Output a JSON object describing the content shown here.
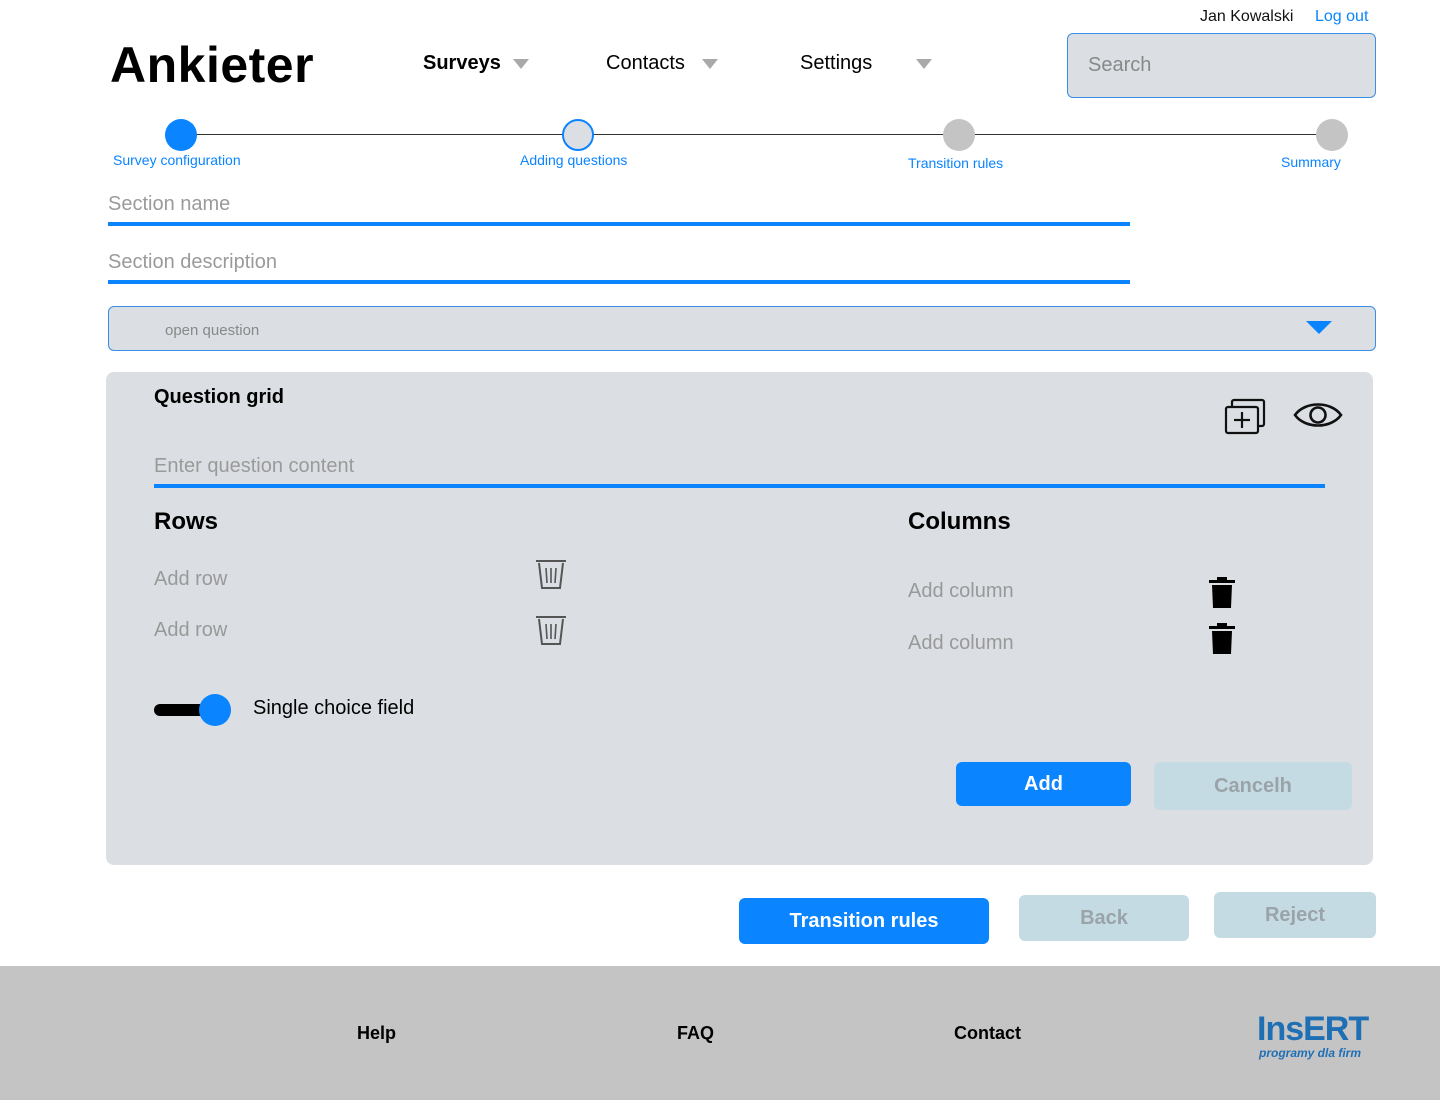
{
  "user": {
    "name": "Jan Kowalski",
    "logout_label": "Log out"
  },
  "app": {
    "title": "Ankieter"
  },
  "nav": [
    {
      "label": "Surveys",
      "active": true
    },
    {
      "label": "Contacts",
      "active": false
    },
    {
      "label": "Settings",
      "active": false
    }
  ],
  "search": {
    "placeholder": "Search"
  },
  "stepper": {
    "steps": [
      {
        "label": "Survey configuration",
        "state": "completed"
      },
      {
        "label": "Adding questions",
        "state": "current"
      },
      {
        "label": "Transition rules",
        "state": "pending"
      },
      {
        "label": "Summary",
        "state": "pending"
      }
    ]
  },
  "section": {
    "name_placeholder": "Section name",
    "description_placeholder": "Section description"
  },
  "question_type": {
    "selected": "open question"
  },
  "question_grid": {
    "title": "Question grid",
    "content_placeholder": "Enter question content",
    "rows_title": "Rows",
    "columns_title": "Columns",
    "rows": [
      {
        "placeholder": "Add row"
      },
      {
        "placeholder": "Add row"
      }
    ],
    "columns": [
      {
        "placeholder": "Add column"
      },
      {
        "placeholder": "Add column"
      }
    ],
    "toggle": {
      "label": "Single choice field",
      "on": true
    },
    "add_label": "Add",
    "cancel_label": "Cancelh"
  },
  "actions": {
    "transition_label": "Transition rules",
    "back_label": "Back",
    "reject_label": "Reject"
  },
  "footer": {
    "links": [
      "Help",
      "FAQ",
      "Contact"
    ],
    "brand": {
      "name": "InsERT",
      "tagline": "programy dla firm"
    }
  },
  "colors": {
    "accent": "#0a84ff",
    "panel": "#dbdfe3",
    "disabled_button": "#c5dbe3",
    "footer": "#c4c4c4",
    "brand": "#1f6fb5"
  },
  "icons": {
    "add_question": "duplicate-add-icon",
    "preview": "eye-icon",
    "row_delete": "trash-outline-icon",
    "column_delete": "trash-filled-icon"
  }
}
